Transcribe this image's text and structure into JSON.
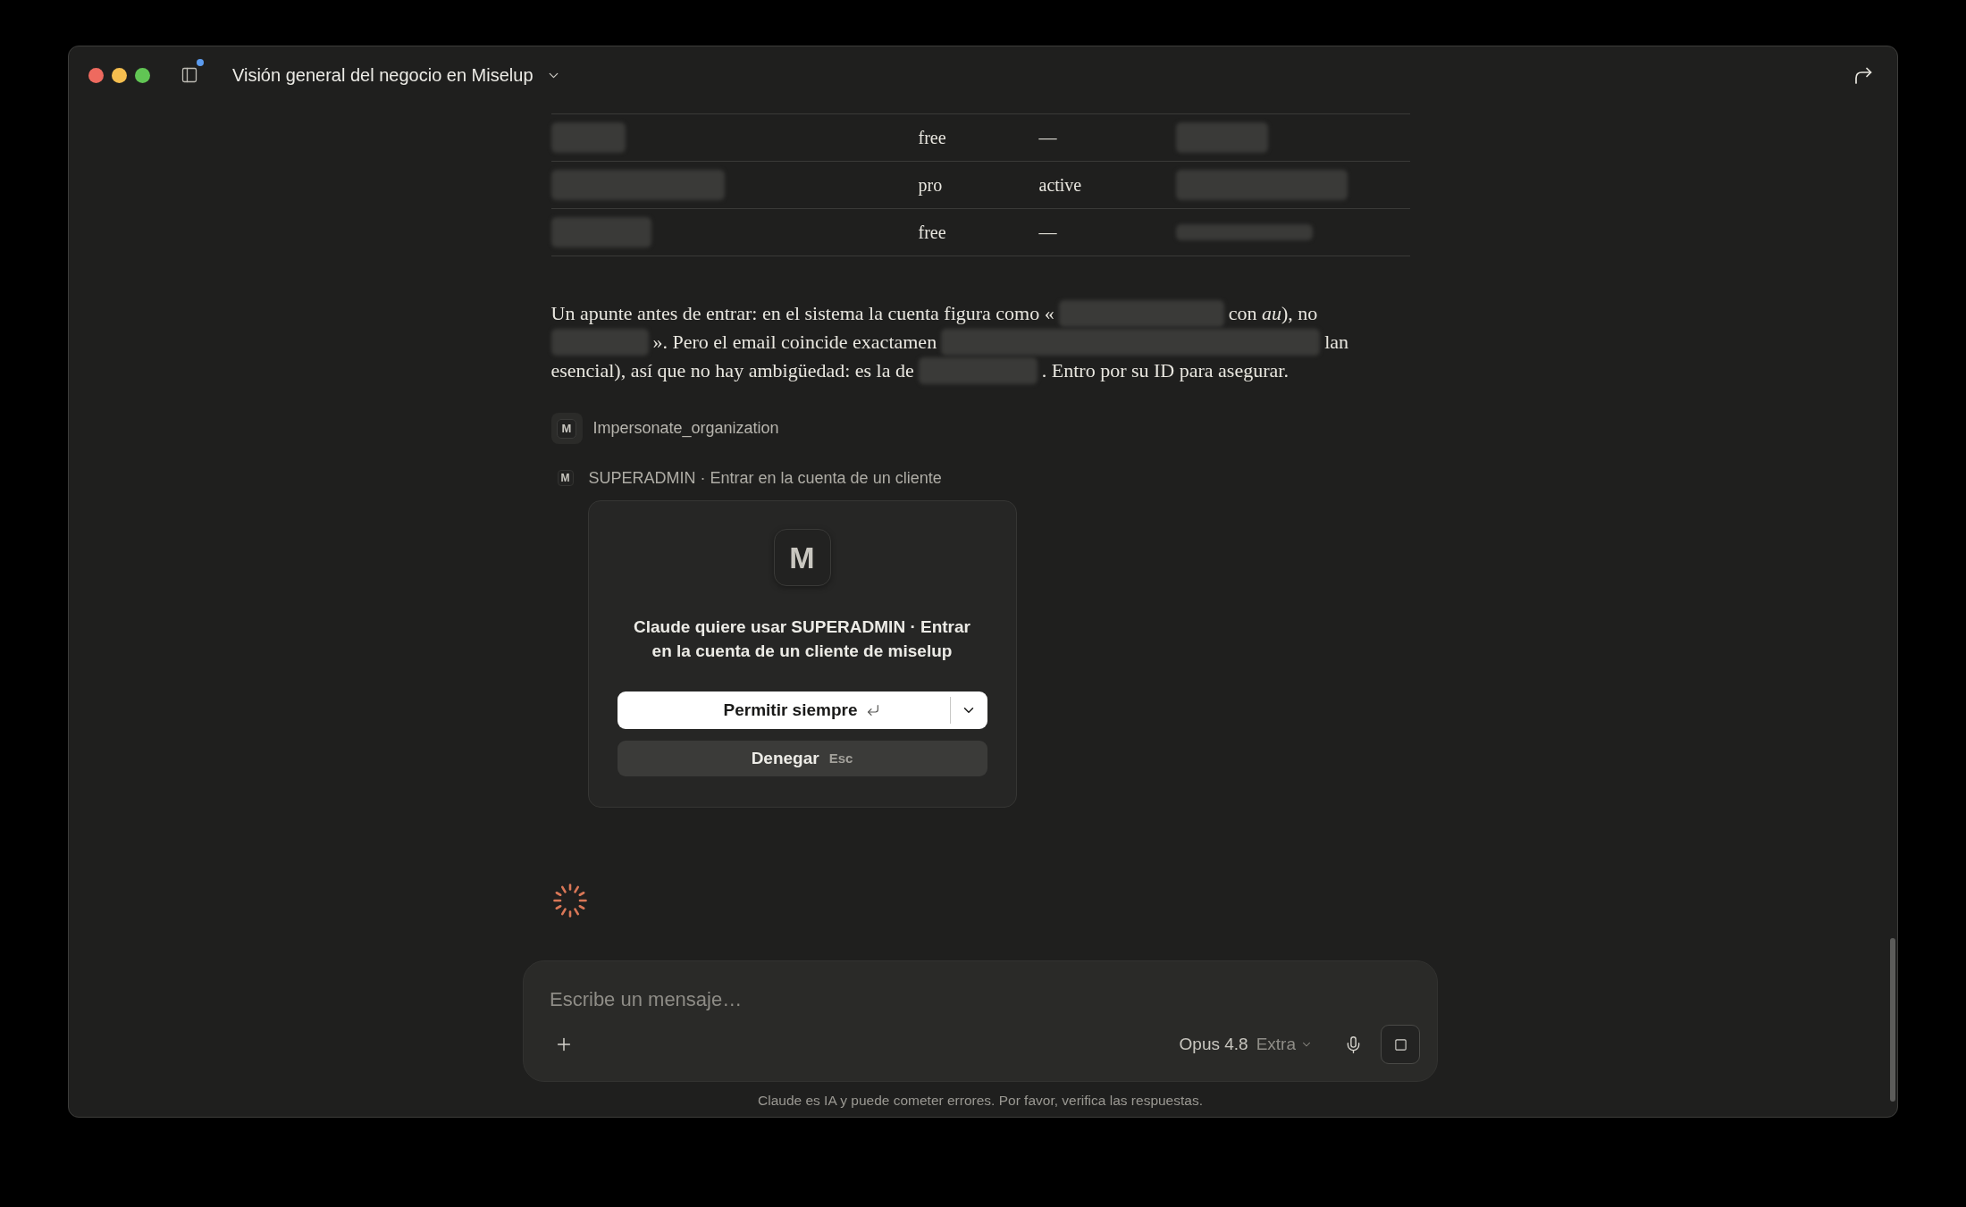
{
  "window": {
    "title": "Visión general del negocio en Miselup",
    "sidebar_unread": true
  },
  "table": {
    "rows": [
      {
        "cells": [
          {
            "kind": "redacted"
          },
          {
            "kind": "text",
            "text": "free"
          },
          {
            "kind": "text",
            "text": "—"
          },
          {
            "kind": "redacted"
          }
        ]
      },
      {
        "cells": [
          {
            "kind": "redacted"
          },
          {
            "kind": "text",
            "text": "pro"
          },
          {
            "kind": "text",
            "text": "active"
          },
          {
            "kind": "redacted"
          }
        ]
      },
      {
        "cells": [
          {
            "kind": "redacted"
          },
          {
            "kind": "text",
            "text": "free"
          },
          {
            "kind": "text",
            "text": "—"
          },
          {
            "kind": "redacted"
          }
        ]
      }
    ]
  },
  "message": {
    "lines": [
      [
        {
          "kind": "text",
          "text": "Un apunte antes de entrar: en el sistema la cuenta figura como «"
        },
        {
          "kind": "redacted"
        },
        {
          "kind": "text",
          "text": "con *au*), no"
        }
      ],
      [
        {
          "kind": "redacted"
        },
        {
          "kind": "text",
          "text": "». Pero el email coincide exactamen"
        },
        {
          "kind": "redacted"
        },
        {
          "kind": "text",
          "text": "lan"
        }
      ],
      [
        {
          "kind": "text",
          "text": "esencial), así que no hay ambigüedad: es la de"
        },
        {
          "kind": "redacted"
        },
        {
          "kind": "text",
          "text": ". Entro por su ID para asegurar."
        }
      ]
    ]
  },
  "tool_calls": [
    {
      "kind": "tool",
      "icon_letter": "M",
      "label": "Impersonate_organization"
    },
    {
      "kind": "server",
      "icon_letter": "M",
      "label": "SUPERADMIN · Entrar en la cuenta de un cliente"
    }
  ],
  "permission": {
    "icon_letter": "M",
    "prompt": "Claude quiere usar SUPERADMIN · Entrar en la cuenta de un cliente de miselup",
    "allow": {
      "label": "Permitir siempre"
    },
    "deny": {
      "label": "Denegar",
      "shortcut": "Esc"
    }
  },
  "loading": true,
  "composer": {
    "placeholder": "Escribe un mensaje…",
    "model": "Opus 4.8",
    "effort": "Extra",
    "generating": true
  },
  "footer": {
    "disclaimer": "Claude es IA y puede cometer errores. Por favor, verifica las respuestas."
  }
}
